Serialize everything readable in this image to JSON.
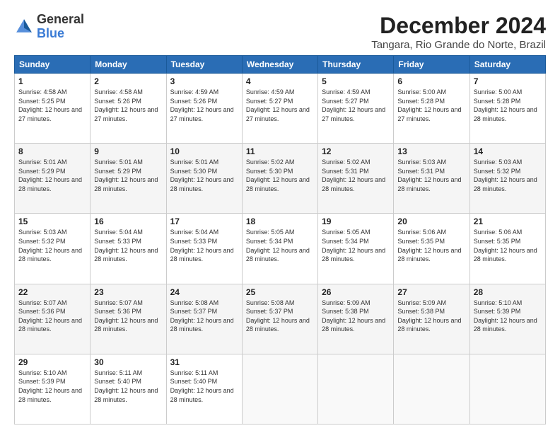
{
  "logo": {
    "general": "General",
    "blue": "Blue"
  },
  "title": "December 2024",
  "subtitle": "Tangara, Rio Grande do Norte, Brazil",
  "days_header": [
    "Sunday",
    "Monday",
    "Tuesday",
    "Wednesday",
    "Thursday",
    "Friday",
    "Saturday"
  ],
  "weeks": [
    [
      {
        "day": "1",
        "sunrise": "4:58 AM",
        "sunset": "5:25 PM",
        "daylight": "12 hours and 27 minutes."
      },
      {
        "day": "2",
        "sunrise": "4:58 AM",
        "sunset": "5:26 PM",
        "daylight": "12 hours and 27 minutes."
      },
      {
        "day": "3",
        "sunrise": "4:59 AM",
        "sunset": "5:26 PM",
        "daylight": "12 hours and 27 minutes."
      },
      {
        "day": "4",
        "sunrise": "4:59 AM",
        "sunset": "5:27 PM",
        "daylight": "12 hours and 27 minutes."
      },
      {
        "day": "5",
        "sunrise": "4:59 AM",
        "sunset": "5:27 PM",
        "daylight": "12 hours and 27 minutes."
      },
      {
        "day": "6",
        "sunrise": "5:00 AM",
        "sunset": "5:28 PM",
        "daylight": "12 hours and 27 minutes."
      },
      {
        "day": "7",
        "sunrise": "5:00 AM",
        "sunset": "5:28 PM",
        "daylight": "12 hours and 28 minutes."
      }
    ],
    [
      {
        "day": "8",
        "sunrise": "5:01 AM",
        "sunset": "5:29 PM",
        "daylight": "12 hours and 28 minutes."
      },
      {
        "day": "9",
        "sunrise": "5:01 AM",
        "sunset": "5:29 PM",
        "daylight": "12 hours and 28 minutes."
      },
      {
        "day": "10",
        "sunrise": "5:01 AM",
        "sunset": "5:30 PM",
        "daylight": "12 hours and 28 minutes."
      },
      {
        "day": "11",
        "sunrise": "5:02 AM",
        "sunset": "5:30 PM",
        "daylight": "12 hours and 28 minutes."
      },
      {
        "day": "12",
        "sunrise": "5:02 AM",
        "sunset": "5:31 PM",
        "daylight": "12 hours and 28 minutes."
      },
      {
        "day": "13",
        "sunrise": "5:03 AM",
        "sunset": "5:31 PM",
        "daylight": "12 hours and 28 minutes."
      },
      {
        "day": "14",
        "sunrise": "5:03 AM",
        "sunset": "5:32 PM",
        "daylight": "12 hours and 28 minutes."
      }
    ],
    [
      {
        "day": "15",
        "sunrise": "5:03 AM",
        "sunset": "5:32 PM",
        "daylight": "12 hours and 28 minutes."
      },
      {
        "day": "16",
        "sunrise": "5:04 AM",
        "sunset": "5:33 PM",
        "daylight": "12 hours and 28 minutes."
      },
      {
        "day": "17",
        "sunrise": "5:04 AM",
        "sunset": "5:33 PM",
        "daylight": "12 hours and 28 minutes."
      },
      {
        "day": "18",
        "sunrise": "5:05 AM",
        "sunset": "5:34 PM",
        "daylight": "12 hours and 28 minutes."
      },
      {
        "day": "19",
        "sunrise": "5:05 AM",
        "sunset": "5:34 PM",
        "daylight": "12 hours and 28 minutes."
      },
      {
        "day": "20",
        "sunrise": "5:06 AM",
        "sunset": "5:35 PM",
        "daylight": "12 hours and 28 minutes."
      },
      {
        "day": "21",
        "sunrise": "5:06 AM",
        "sunset": "5:35 PM",
        "daylight": "12 hours and 28 minutes."
      }
    ],
    [
      {
        "day": "22",
        "sunrise": "5:07 AM",
        "sunset": "5:36 PM",
        "daylight": "12 hours and 28 minutes."
      },
      {
        "day": "23",
        "sunrise": "5:07 AM",
        "sunset": "5:36 PM",
        "daylight": "12 hours and 28 minutes."
      },
      {
        "day": "24",
        "sunrise": "5:08 AM",
        "sunset": "5:37 PM",
        "daylight": "12 hours and 28 minutes."
      },
      {
        "day": "25",
        "sunrise": "5:08 AM",
        "sunset": "5:37 PM",
        "daylight": "12 hours and 28 minutes."
      },
      {
        "day": "26",
        "sunrise": "5:09 AM",
        "sunset": "5:38 PM",
        "daylight": "12 hours and 28 minutes."
      },
      {
        "day": "27",
        "sunrise": "5:09 AM",
        "sunset": "5:38 PM",
        "daylight": "12 hours and 28 minutes."
      },
      {
        "day": "28",
        "sunrise": "5:10 AM",
        "sunset": "5:39 PM",
        "daylight": "12 hours and 28 minutes."
      }
    ],
    [
      {
        "day": "29",
        "sunrise": "5:10 AM",
        "sunset": "5:39 PM",
        "daylight": "12 hours and 28 minutes."
      },
      {
        "day": "30",
        "sunrise": "5:11 AM",
        "sunset": "5:40 PM",
        "daylight": "12 hours and 28 minutes."
      },
      {
        "day": "31",
        "sunrise": "5:11 AM",
        "sunset": "5:40 PM",
        "daylight": "12 hours and 28 minutes."
      },
      null,
      null,
      null,
      null
    ]
  ]
}
